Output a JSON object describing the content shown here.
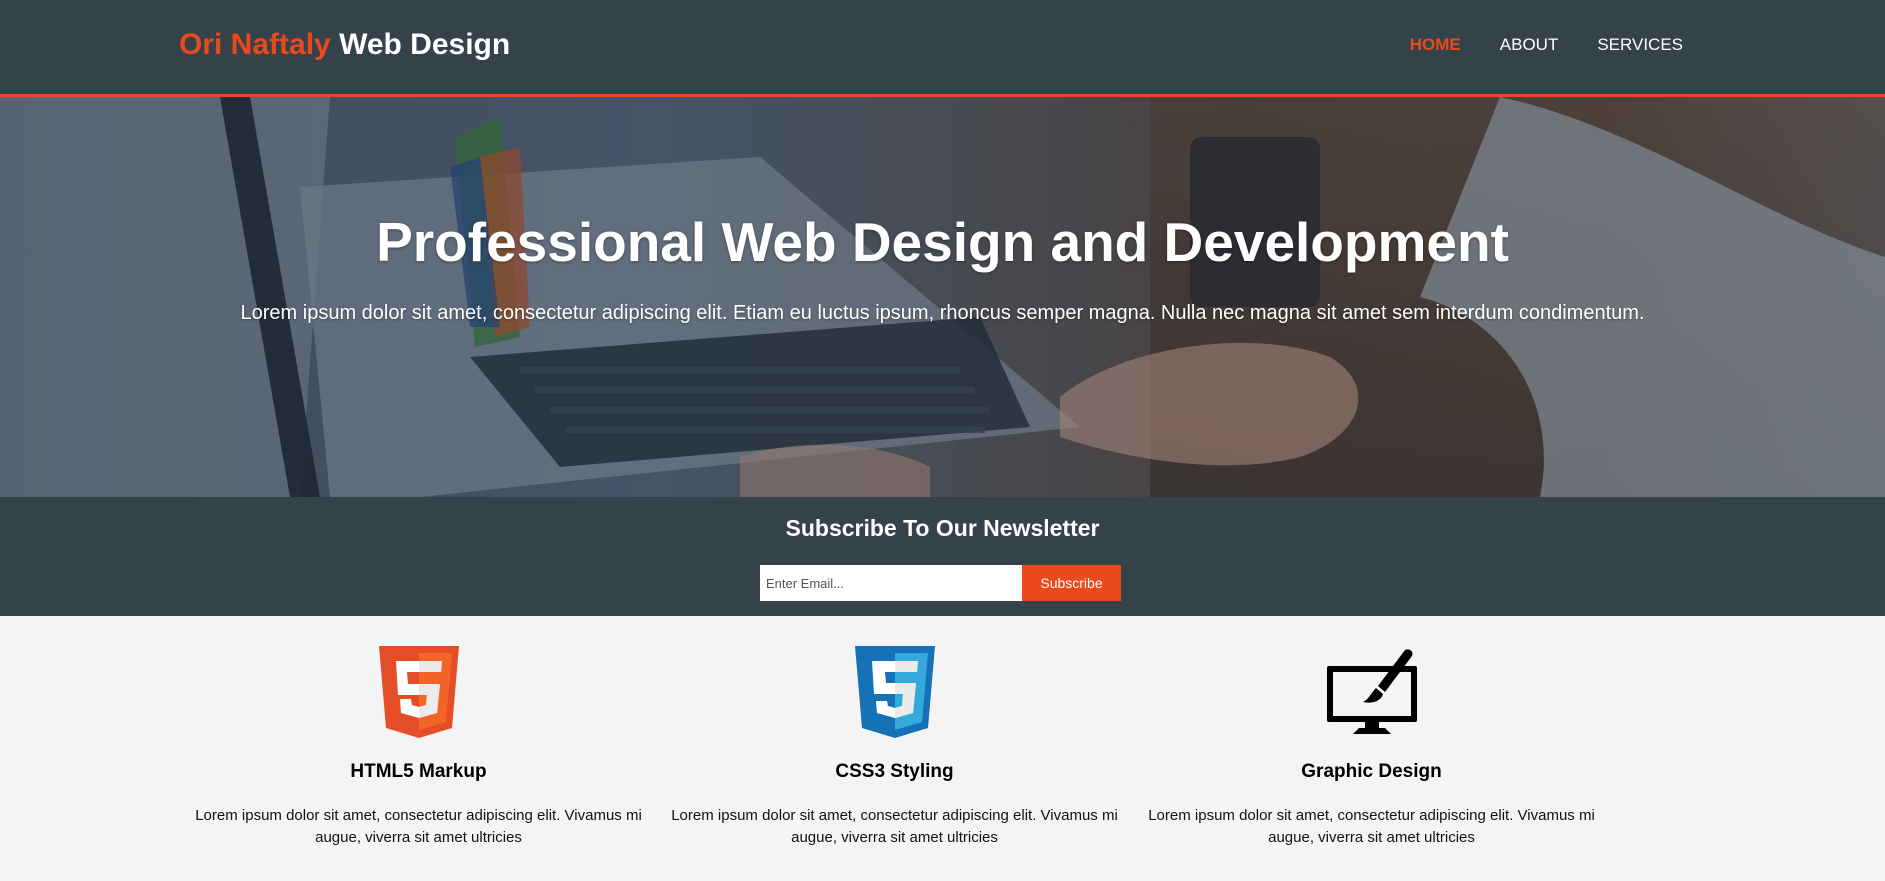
{
  "header": {
    "brand_highlight": "Ori Naftaly",
    "brand_rest": "Web Design",
    "nav": [
      {
        "label": "HOME",
        "active": true
      },
      {
        "label": "ABOUT",
        "active": false
      },
      {
        "label": "SERVICES",
        "active": false
      }
    ]
  },
  "showcase": {
    "title": "Professional Web Design and Development",
    "text": "Lorem ipsum dolor sit amet, consectetur adipiscing elit. Etiam eu luctus ipsum, rhoncus semper magna. Nulla nec magna sit amet sem interdum condimentum."
  },
  "newsletter": {
    "title": "Subscribe To Our Newsletter",
    "email_placeholder": "Enter Email...",
    "button_label": "Subscribe"
  },
  "boxes": [
    {
      "icon": "html5-logo-icon",
      "title": "HTML5 Markup",
      "text": "Lorem ipsum dolor sit amet, consectetur adipiscing elit. Vivamus mi augue, viverra sit amet ultricies"
    },
    {
      "icon": "css3-logo-icon",
      "title": "CSS3 Styling",
      "text": "Lorem ipsum dolor sit amet, consectetur adipiscing elit. Vivamus mi augue, viverra sit amet ultricies"
    },
    {
      "icon": "monitor-brush-icon",
      "title": "Graphic Design",
      "text": "Lorem ipsum dolor sit amet, consectetur adipiscing elit. Vivamus mi augue, viverra sit amet ultricies"
    }
  ],
  "colors": {
    "header_bg": "#35424a",
    "accent": "#e8491d",
    "body_bg": "#f4f4f4",
    "css3_blue": "#2162b0"
  }
}
